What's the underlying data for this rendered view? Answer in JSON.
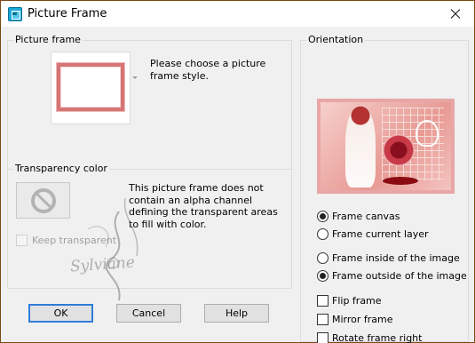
{
  "window": {
    "title": "Picture Frame"
  },
  "picture_frame": {
    "label": "Picture frame",
    "message": "Please choose a picture frame style."
  },
  "transparency": {
    "label": "Transparency color",
    "message": "This picture frame does not contain an alpha channel defining the transparent areas to fill with color.",
    "keep_transparent": {
      "label": "Keep transparent",
      "checked": false,
      "enabled": false
    }
  },
  "watermark": "Sylviane",
  "orientation": {
    "label": "Orientation",
    "radios_target": [
      {
        "label": "Frame canvas",
        "selected": true
      },
      {
        "label": "Frame current layer",
        "selected": false
      }
    ],
    "radios_position": [
      {
        "label": "Frame inside of the image",
        "selected": false
      },
      {
        "label": "Frame outside of the image",
        "selected": true
      }
    ],
    "checks": [
      {
        "label": "Flip frame",
        "checked": false
      },
      {
        "label": "Mirror frame",
        "checked": false
      },
      {
        "label": "Rotate frame right",
        "checked": false
      }
    ]
  },
  "buttons": {
    "ok": "OK",
    "cancel": "Cancel",
    "help": "Help"
  },
  "colors": {
    "title_bar_border": "#7a4a12",
    "frame_color": "#d67575",
    "default_button_border": "#2f7cd7"
  }
}
